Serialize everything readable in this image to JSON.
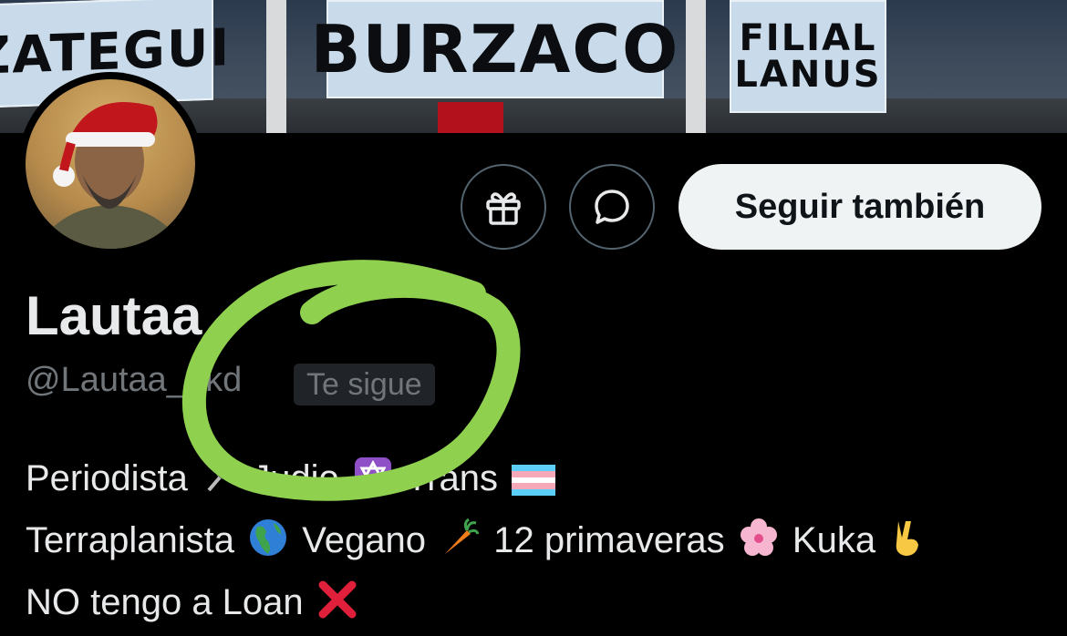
{
  "banner": {
    "flag_left": "ZATEGUI",
    "flag_center": "BURZACO",
    "flag_right_top": "FILIAL",
    "flag_right_bottom": "LANUS"
  },
  "profile": {
    "display_name": "Lautaa",
    "handle": "@Lautaa_akd",
    "follows_you_badge": "Te sigue"
  },
  "actions": {
    "gift_icon": "gift-icon",
    "message_icon": "message-bubble-icon",
    "follow_label": "Seguir también"
  },
  "bio": {
    "line1": [
      {
        "text": "Periodista",
        "emoji": "microphone-icon"
      },
      {
        "text": "Judio",
        "emoji": "star-of-david-icon"
      },
      {
        "text": "Trans",
        "emoji": "transgender-flag-icon"
      }
    ],
    "line2": [
      {
        "text": "Terraplanista",
        "emoji": "globe-americas-icon"
      },
      {
        "text": "Vegano",
        "emoji": "carrot-icon"
      },
      {
        "text": "12 primaveras",
        "emoji": "cherry-blossom-icon"
      },
      {
        "text": "Kuka",
        "emoji": "victory-hand-icon"
      }
    ],
    "line3": [
      {
        "text": "NO tengo a Loan",
        "emoji": "cross-mark-icon"
      }
    ]
  },
  "colors": {
    "background": "#000000",
    "primary_text": "#e7e9ea",
    "secondary_text": "#71767b",
    "button_fill": "#eff3f4",
    "annotation_green": "#8fd14f"
  }
}
